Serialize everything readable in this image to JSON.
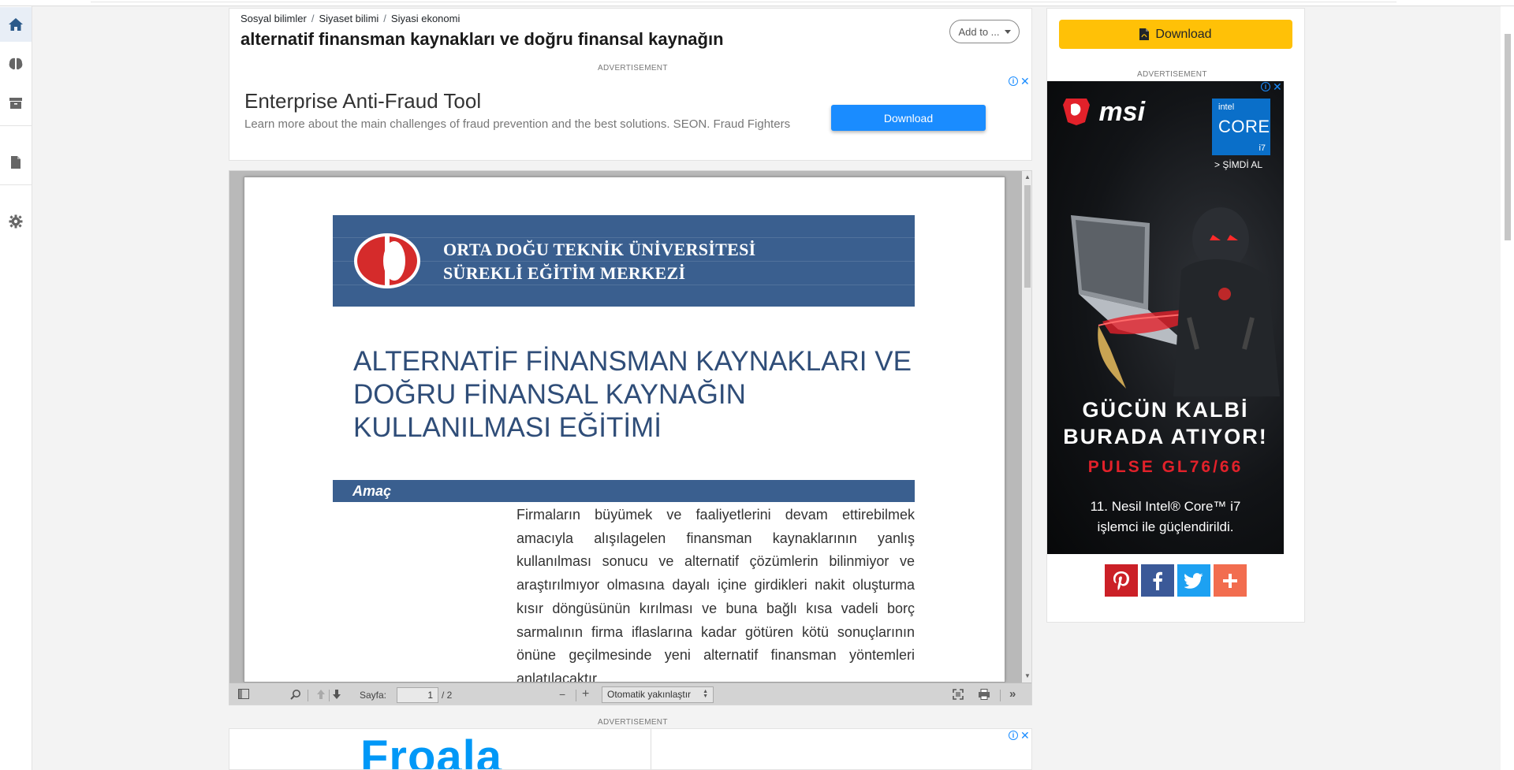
{
  "breadcrumb": [
    "Sosyal bilimler",
    "Siyaset bilimi",
    "Siyasi ekonomi"
  ],
  "document": {
    "title": "alternatif finansman kaynakları ve doğru finansal kaynağın",
    "add_to_label": "Add to ..."
  },
  "ad_label": "ADVERTISEMENT",
  "ad_top": {
    "title": "Enterprise Anti-Fraud Tool",
    "text": "Learn more about the main challenges of fraud prevention and the best solutions. SEON. Fraud Fighters",
    "button": "Download"
  },
  "pdf_page": {
    "university_line1": "ORTA DOĞU TEKNİK ÜNİVERSİTESİ",
    "university_line2": "SÜREKLİ EĞİTİM MERKEZİ",
    "course_title": "ALTERNATİF FİNANSMAN KAYNAKLARI VE DOĞRU FİNANSAL KAYNAĞIN KULLANILMASI EĞİTİMİ",
    "section_heading": "Amaç",
    "body": "Firmaların büyümek ve faaliyetlerini devam ettirebilmek amacıyla alışılagelen finansman kaynaklarının yanlış kullanılması sonucu ve alternatif çözümlerin bilinmiyor ve araştırılmıyor olmasına dayalı içine girdikleri nakit oluşturma kısır döngüsünün kırılması ve buna bağlı kısa vadeli borç sarmalının firma iflaslarına kadar götüren kötü sonuçlarının önüne geçilmesinde yeni alternatif finansman yöntemleri anlatılacaktır."
  },
  "viewer_toolbar": {
    "page_label": "Sayfa:",
    "page_current": "1",
    "page_total": "/ 2",
    "zoom_value": "Otomatik yakınlaştır"
  },
  "ad_bottom": {
    "brand": "Froala"
  },
  "sidebar": {
    "download_label": "Download",
    "msi_ad": {
      "brand": "msi",
      "intel_line1": "intel",
      "intel_line2": "CORE",
      "intel_line3": "i7",
      "cta": "> ŞİMDİ AL",
      "slogan_line1": "GÜCÜN KALBİ",
      "slogan_line2": "BURADA ATIYOR!",
      "model": "PULSE GL76/66",
      "cpu_line1": "11. Nesil Intel® Core™ i7",
      "cpu_line2": "işlemci ile güçlendirildi."
    },
    "share_buttons": [
      {
        "name": "pinterest",
        "color": "#cb2027"
      },
      {
        "name": "facebook",
        "color": "#3b5998"
      },
      {
        "name": "twitter",
        "color": "#1da1f2"
      },
      {
        "name": "more",
        "color": "#f26d4f"
      }
    ]
  },
  "colors": {
    "accent_yellow": "#ffc107",
    "pdf_banner": "#3a5f8f",
    "ad_button": "#1a8cff"
  }
}
